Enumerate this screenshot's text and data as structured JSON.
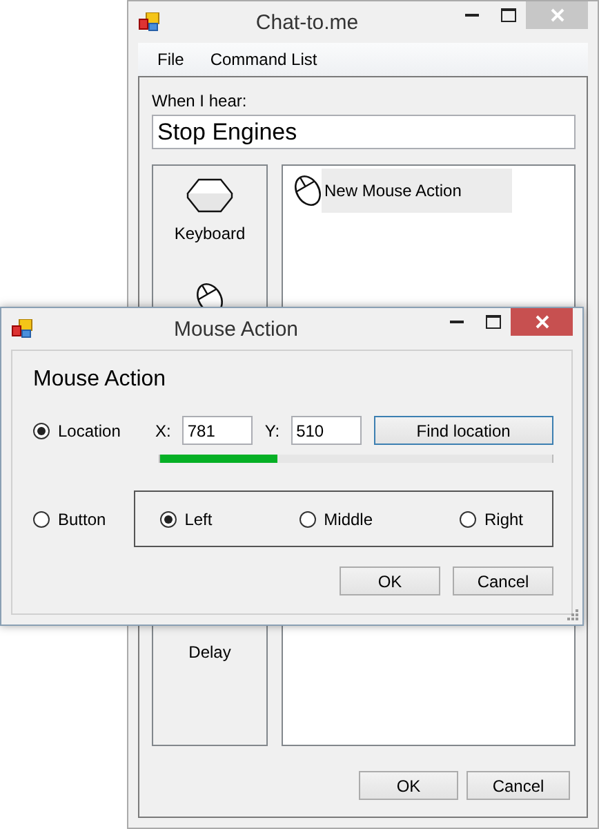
{
  "main_window": {
    "title": "Chat-to.me",
    "active": false,
    "menu": [
      "File",
      "Command List"
    ],
    "trigger": {
      "label": "When I hear:",
      "value": "Stop Engines"
    },
    "tools": [
      {
        "kind": "keyboard",
        "label": "Keyboard"
      },
      {
        "kind": "mouse"
      },
      {
        "kind": "delay",
        "label": "Delay"
      }
    ],
    "actions": [
      {
        "kind": "mouse",
        "label": "New Mouse Action",
        "selected": true
      }
    ],
    "buttons": [
      "OK",
      "Cancel"
    ]
  },
  "dialog": {
    "title": "Mouse Action",
    "active": true,
    "heading": "Mouse Action",
    "location": {
      "label": "Location",
      "selected": true,
      "x_label": "X:",
      "x_value": "781",
      "y_label": "Y:",
      "y_value": "510",
      "find_button": "Find location",
      "find_focused": true,
      "level": 0.3
    },
    "button_option": {
      "label": "Button",
      "selected": false
    },
    "mouse_buttons": [
      {
        "label": "Left",
        "selected": true
      },
      {
        "label": "Middle",
        "selected": false
      },
      {
        "label": "Right",
        "selected": false
      }
    ],
    "buttons": [
      "OK",
      "Cancel"
    ]
  }
}
